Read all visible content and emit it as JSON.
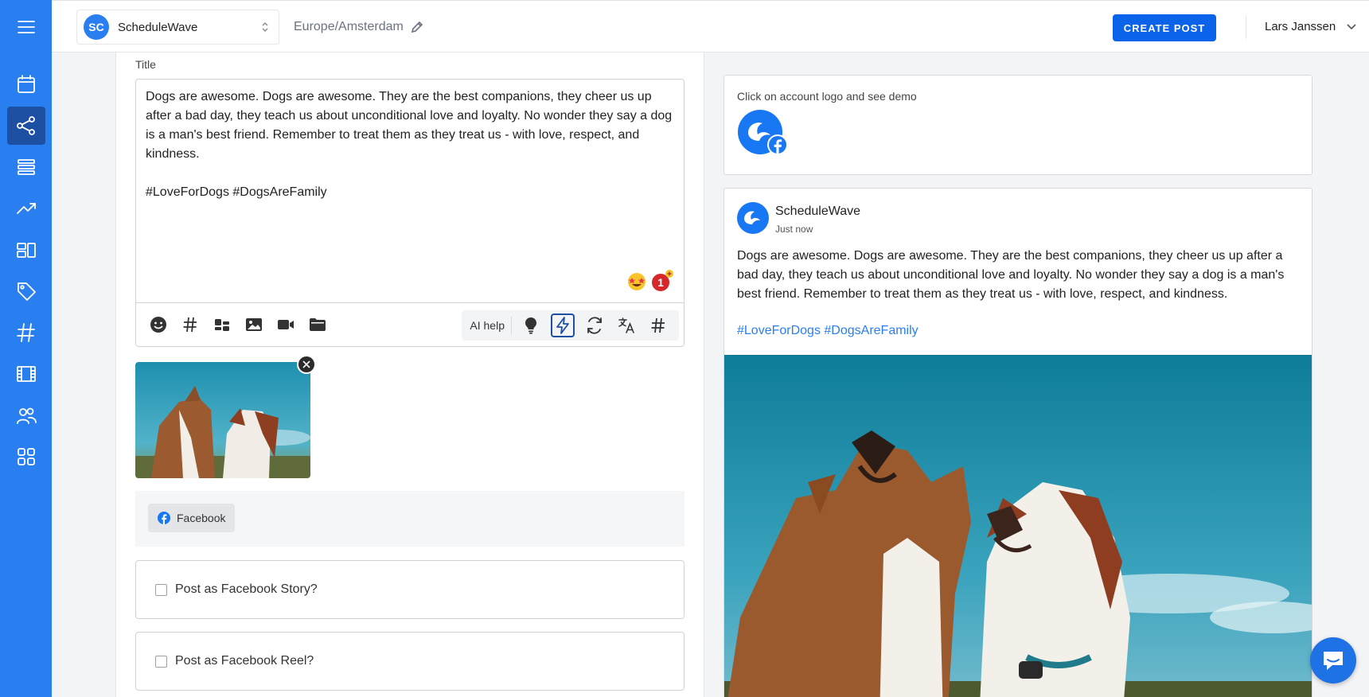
{
  "header": {
    "brand_initials": "SC",
    "brand_name": "ScheduleWave",
    "timezone": "Europe/Amsterdam",
    "create_label": "CREATE POST",
    "user_name": "Lars Janssen"
  },
  "sidebar": {
    "items": [
      {
        "icon": "menu-icon"
      },
      {
        "icon": "calendar-icon"
      },
      {
        "icon": "share-icon",
        "active": true
      },
      {
        "icon": "list-icon"
      },
      {
        "icon": "trending-icon"
      },
      {
        "icon": "layout-icon"
      },
      {
        "icon": "tag-icon"
      },
      {
        "icon": "hashtag-icon"
      },
      {
        "icon": "film-icon"
      },
      {
        "icon": "users-icon"
      },
      {
        "icon": "apps-icon"
      }
    ]
  },
  "editor": {
    "title_label": "Title",
    "text": "Dogs are awesome. Dogs are awesome. They are the best companions, they cheer us up after a bad day, they teach us about unconditional love and loyalty. No wonder they say a dog is a man's best friend. Remember to treat them as they treat us - with love, respect, and kindness.\n\n#LoveForDogs #DogsAreFamily",
    "emoji_badge": "1",
    "ai_help_label": "AI help",
    "network_label": "Facebook",
    "option_story": "Post as Facebook Story?",
    "option_reel": "Post as Facebook Reel?"
  },
  "preview": {
    "demo_text": "Click on account logo and see demo",
    "post_name": "ScheduleWave",
    "post_time": "Just now",
    "post_text": "Dogs are awesome. Dogs are awesome. They are the best companions, they cheer us up after a bad day, they teach us about unconditional love and loyalty. No wonder they say a dog is a man's best friend. Remember to treat them as they treat us - with love, respect, and kindness.",
    "post_tags": "#LoveForDogs #DogsAreFamily"
  },
  "colors": {
    "sidebar": "#2a7ff0",
    "sidebar_active": "#1d4fa3",
    "primary_button": "#0a63e9",
    "hashtag_link": "#2a7ff0"
  }
}
